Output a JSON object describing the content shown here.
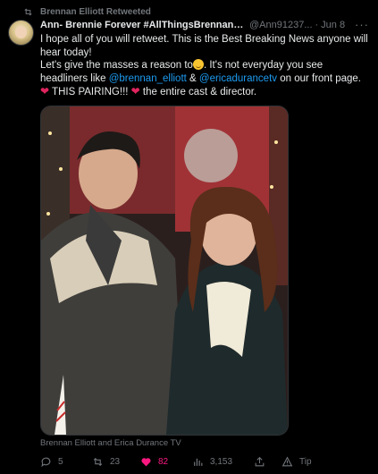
{
  "retweet": {
    "label": "Brennan Elliott Retweeted",
    "icon": "retweet-icon"
  },
  "tweet": {
    "display_name": "Ann- Brennie Forever #AllThingsBrennanEl...",
    "handle": "@Ann91237...",
    "separator": "·",
    "date": "Jun 8",
    "more_icon": "more-icon",
    "text": {
      "line1": "I hope all of you will retweet.  This is  the Best  Breaking News anyone will hear today!",
      "line2_pre": "Let's give the masses a reason to",
      "line2_post": ".  It's not everyday you see headliners like ",
      "mention1": "@brennan_elliott",
      "amp": " & ",
      "mention2": "@ericadurancetv",
      "line2_tail": " on our front page. ",
      "heart1": "❤",
      "this_pairing": " THIS PAIRING!!! ",
      "heart2": "❤",
      "closing": " the entire cast & director."
    },
    "media_caption": "Brennan Elliott and Erica Durance TV"
  },
  "actions": {
    "replies": "5",
    "retweets": "23",
    "likes": "82",
    "views": "3,153",
    "tip": "Tip",
    "like_color": "#f91880"
  }
}
